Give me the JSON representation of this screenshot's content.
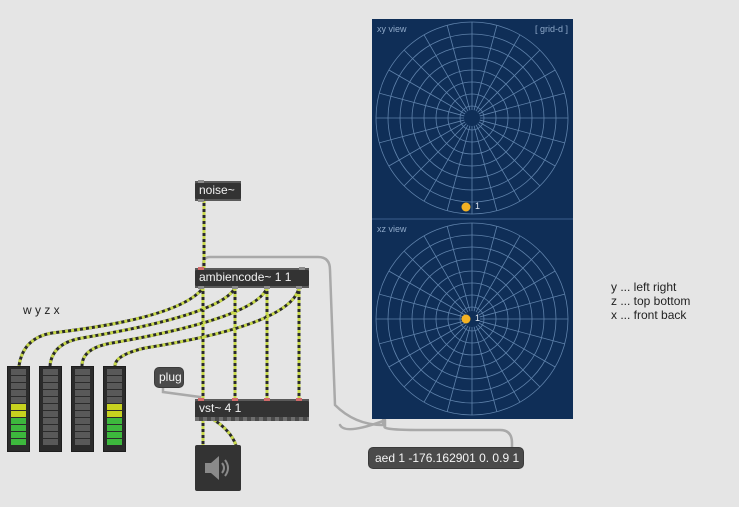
{
  "objects": {
    "noise": "noise~",
    "ambiencode": "ambiencode~ 1 1",
    "vst": "vst~ 4 1"
  },
  "plug_message": "plug",
  "aed_message": "aed 1 -176.162901 0. 0.9 1",
  "meters_label": "w y z x",
  "meters": [
    {
      "level": 0.5
    },
    {
      "level": 0.0
    },
    {
      "level": 0.0
    },
    {
      "level": 0.5
    }
  ],
  "panner": {
    "xy_label": "xy view",
    "grid_label": "[ grid-d ]",
    "xz_label": "xz view",
    "source_label": "1",
    "source_color": "#f4b223",
    "background_color": "#0f2e57"
  },
  "legend": [
    "y ... left right",
    "z ... top bottom",
    "x ... front back"
  ],
  "colors": {
    "signal_patchcord": "#c8d94a",
    "message_patchcord": "#a9a9a9",
    "meter_green": "#3db83d",
    "meter_yellow": "#c7d21f"
  },
  "icons": {
    "speaker": "speaker-icon"
  }
}
